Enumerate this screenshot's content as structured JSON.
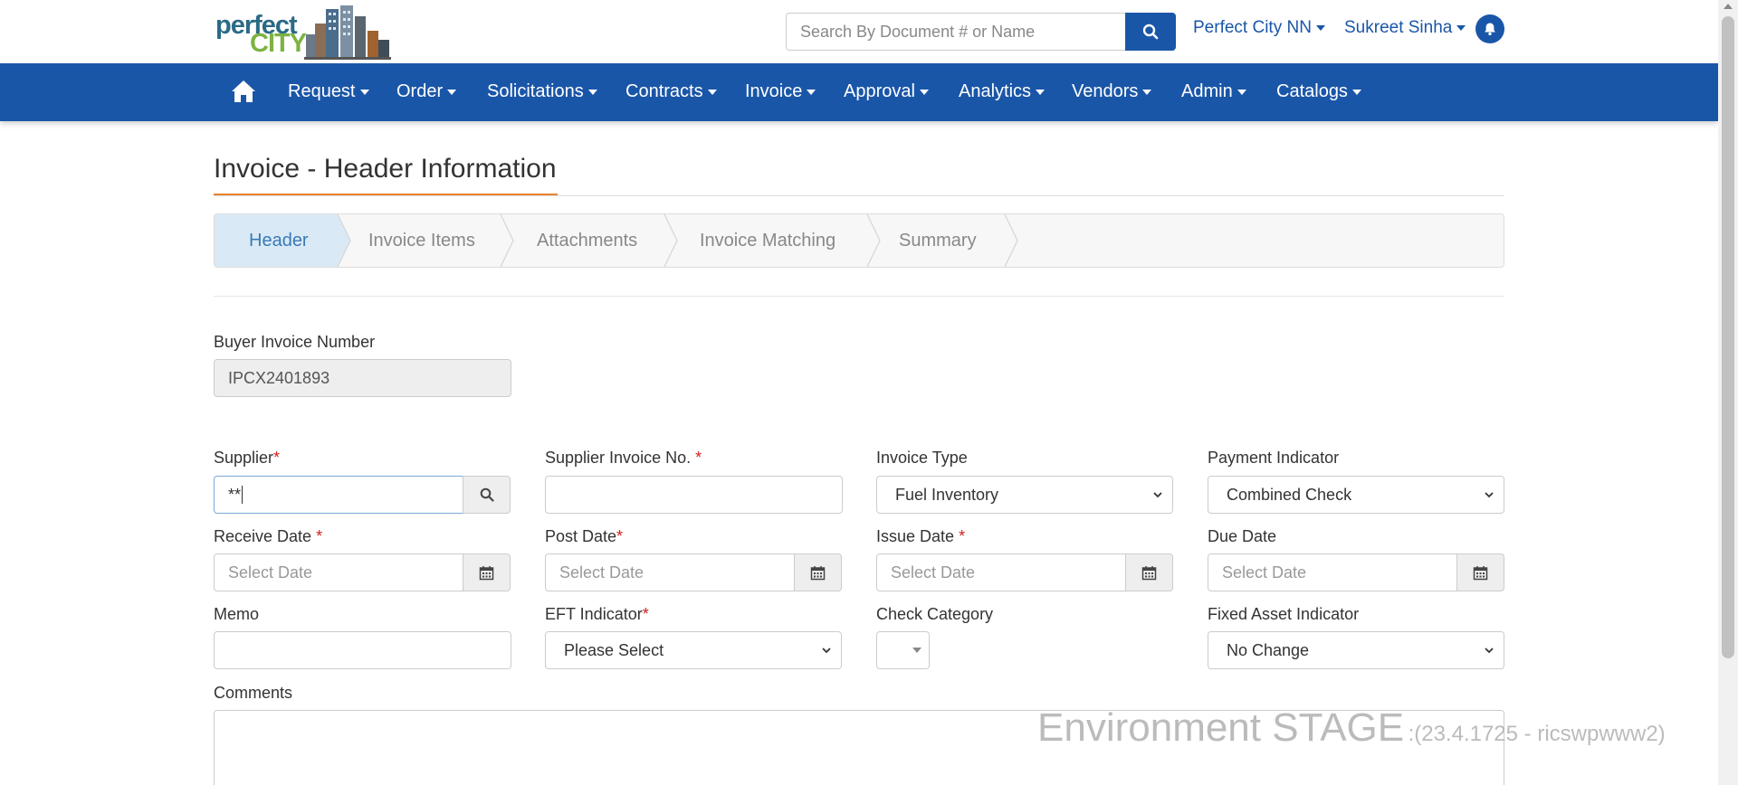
{
  "header": {
    "logo_word1": "perfect",
    "logo_word2": "CITY",
    "search_placeholder": "Search By Document # or Name",
    "org_menu": "Perfect City NN",
    "user_menu": "Sukreet Sinha",
    "accent_color": "#1a56a8"
  },
  "nav": {
    "items": [
      "Request",
      "Order",
      "Solicitations",
      "Contracts",
      "Invoice",
      "Approval",
      "Analytics",
      "Vendors",
      "Admin",
      "Catalogs"
    ]
  },
  "page": {
    "title": "Invoice - Header Information"
  },
  "steps": [
    "Header",
    "Invoice Items",
    "Attachments",
    "Invoice Matching",
    "Summary"
  ],
  "form": {
    "buyer_invoice_number_label": "Buyer Invoice Number",
    "buyer_invoice_number_value": "IPCX2401893",
    "supplier_label": "Supplier",
    "supplier_value": "**",
    "supplier_invoice_no_label": "Supplier Invoice No.",
    "invoice_type_label": "Invoice Type",
    "invoice_type_value": "Fuel Inventory",
    "payment_indicator_label": "Payment Indicator",
    "payment_indicator_value": "Combined Check",
    "receive_date_label": "Receive Date",
    "post_date_label": "Post Date",
    "issue_date_label": "Issue Date",
    "due_date_label": "Due Date",
    "date_placeholder": "Select Date",
    "memo_label": "Memo",
    "eft_indicator_label": "EFT Indicator",
    "eft_indicator_value": "Please Select",
    "check_category_label": "Check Category",
    "fixed_asset_label": "Fixed Asset Indicator",
    "fixed_asset_value": "No Change",
    "comments_label": "Comments",
    "required_mark": "*"
  },
  "environment": {
    "label": "Environment STAGE",
    "detail": ":(23.4.1725 - ricswpwww2)"
  }
}
